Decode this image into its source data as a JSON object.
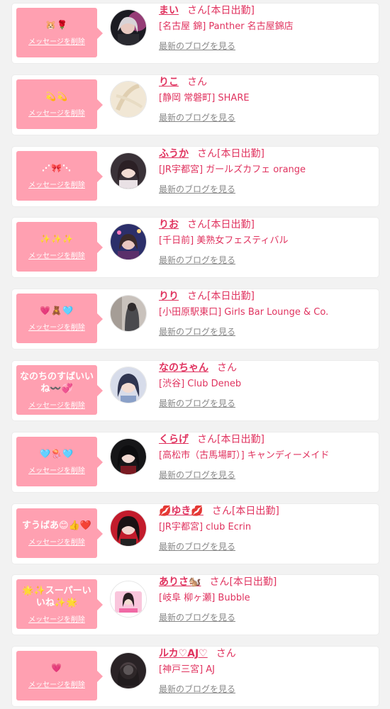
{
  "list": {
    "delete_label": "メッセージを削除",
    "blog_label": "最新のブログを見る",
    "san_label": "さん",
    "items": [
      {
        "message": "🐹🌹",
        "name": "まい",
        "status": "[本日出勤]",
        "shop": "[名古屋 錦] Panther 名古屋錦店",
        "avatar": "dark"
      },
      {
        "message": "💫💫",
        "name": "りこ",
        "status": "",
        "shop": "[静岡 常磐町] SHARE",
        "avatar": "beige"
      },
      {
        "message": "⋰🎀⋱",
        "name": "ふうか",
        "status": "[本日出勤]",
        "shop": "[JR宇都宮] ガールズカフェ orange",
        "avatar": "girl"
      },
      {
        "message": "✨✨✨",
        "name": "りお",
        "status": "[本日出勤]",
        "shop": "[千日前] 美熟女フェスティバル",
        "avatar": "night"
      },
      {
        "message": "💗🧸🩵",
        "name": "りり",
        "status": "[本日出勤]",
        "shop": "[小田原駅東口] Girls Bar Lounge & Co.",
        "avatar": "gray"
      },
      {
        "message": "なのちのすばいいね〰️💞",
        "name": "なのちゃん",
        "status": "",
        "shop": "[渋谷] Club Deneb",
        "avatar": "blue"
      },
      {
        "message": "🩵🪼🩵",
        "name": "くらげ",
        "status": "[本日出勤]",
        "shop": "[高松市（古馬場町）] キャンディーメイド",
        "avatar": "black"
      },
      {
        "message": "すうばあ😊👍❤️",
        "name": "💋ゆき💋",
        "status": "[本日出勤]",
        "shop": "[JR宇都宮] club Ecrin",
        "avatar": "red"
      },
      {
        "message": "🌟✨スーパーいいね✨🌟",
        "name": "ありさ🐿️",
        "status": "[本日出勤]",
        "shop": "[岐阜 柳ヶ瀬] Bubble",
        "avatar": "pink"
      },
      {
        "message": "💗",
        "name": "ルカ♡AJ♡",
        "status": "",
        "shop": "[神戸三宮] AJ",
        "avatar": "shadow"
      }
    ]
  },
  "colors": {
    "accent": "#e0335f",
    "bubble": "#ffa0b1",
    "link_gray": "#888888"
  }
}
